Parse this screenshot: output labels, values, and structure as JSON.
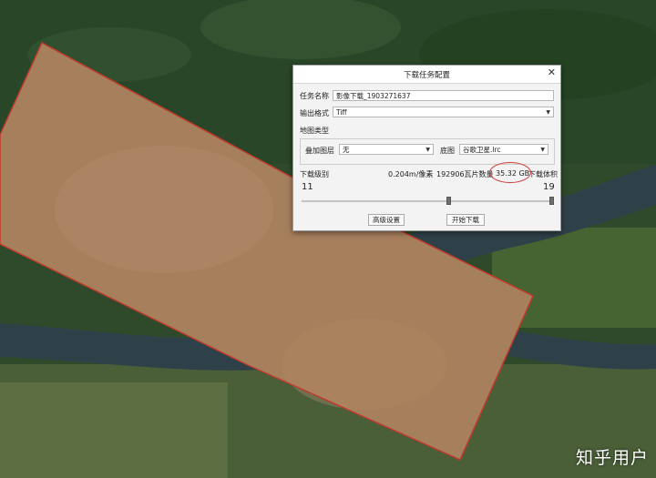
{
  "dialog": {
    "title": "下载任务配置",
    "close_glyph": "✕",
    "task_name_label": "任务名称",
    "task_name_value": "影像下载_1903271637",
    "output_format_label": "输出格式",
    "output_format_value": "Tiff",
    "map_type_label": "地图类型",
    "overlay_label": "叠加图层",
    "overlay_value": "无",
    "basemap_label": "底图",
    "basemap_value": "谷歌卫星.lrc",
    "download_level_label": "下载级别",
    "resolution": "0.204m/像素",
    "tile_count": "192906瓦片数量",
    "size_value": "35.32 GB",
    "size_label": "下载体积",
    "min_level": "11",
    "max_level": "19",
    "advanced_button": "高级设置",
    "start_button": "开始下载"
  },
  "watermark": "知乎用户",
  "icons": {
    "dropdown_caret": "▼"
  },
  "colors": {
    "selection_fill": "#d98e5c",
    "selection_border": "#c0392b",
    "highlight_circle": "#d03a3a"
  }
}
